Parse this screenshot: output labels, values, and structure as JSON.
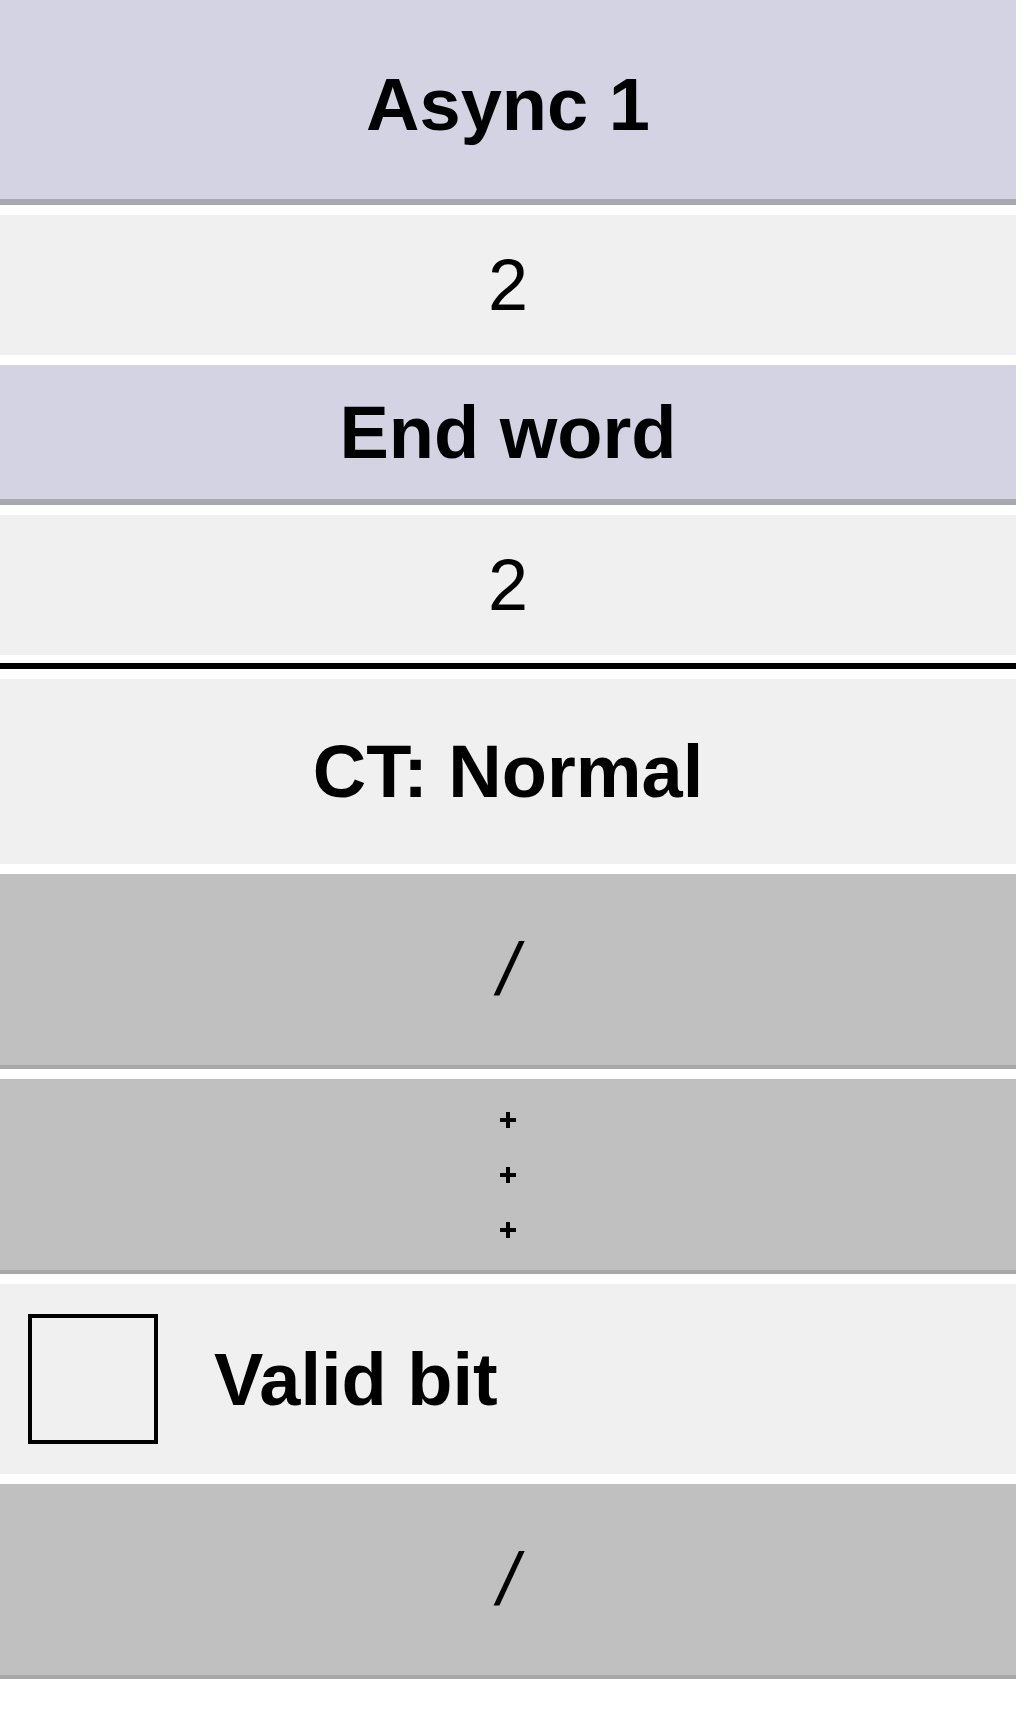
{
  "rows": [
    {
      "kind": "header",
      "text": "Async 1"
    },
    {
      "kind": "value",
      "text": "2"
    },
    {
      "kind": "header",
      "text": "End word"
    },
    {
      "kind": "value",
      "text": "2"
    },
    {
      "kind": "divider"
    },
    {
      "kind": "label",
      "text": "CT: Normal"
    },
    {
      "kind": "disabled",
      "text": "/"
    },
    {
      "kind": "more"
    },
    {
      "kind": "checkbox",
      "label": "Valid bit",
      "checked": false
    },
    {
      "kind": "disabled",
      "text": "/"
    }
  ]
}
